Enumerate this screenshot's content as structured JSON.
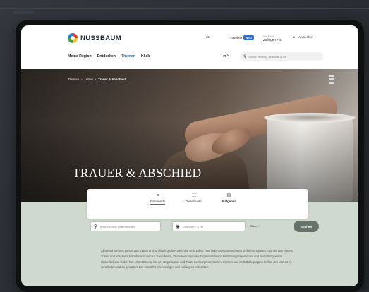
{
  "brand": {
    "name": "NUSSBAUM"
  },
  "header": {
    "lang": "de",
    "business": {
      "label": "Fragebox",
      "badge": "NEU"
    },
    "store": {
      "small": "Ihre Filiale",
      "big": "Zofingen + 4"
    },
    "account": {
      "icon": "person-icon",
      "label": "Anmelden"
    }
  },
  "nav": [
    "Meine Region",
    "Entdecken",
    "Themen",
    "Klick"
  ],
  "nav_active_index": 2,
  "search": {
    "placeholder": "Suche beliebig, Branche & Ort"
  },
  "breadcrumb": [
    "Themen",
    "Leben",
    "Trauer & Abschied"
  ],
  "hero": {
    "title": "TRAUER & ABSCHIED"
  },
  "tabs": [
    {
      "label": "Firmenliste",
      "icon": "list-icon"
    },
    {
      "label": "Dienstleister",
      "icon": "service-icon"
    },
    {
      "label": "Ratgeber",
      "icon": "book-icon"
    }
  ],
  "form": {
    "what_placeholder": "Branche oder Unternehmen",
    "where_placeholder": "Ortschaft + 5 km",
    "radius": "25km",
    "button": "Suchen"
  },
  "intro": "Abschied nehmen gehört zum Leben und ist oft mit großen Gefühlen verbunden. Hier finden Sie Unternehmen und Informationen rund um das Thema Trauer und Abschied. Mit Informationen zu Trauerfeiern, Dienstleistungen der Organisation von Bestattungszeremonien und Bestattungsarten. Hinterbliebene finden hier Unterstützung bei der Organisation und Trost. Seelsorgende Stellen, Kirchen und Selbsthilfegruppen helfen, den Verlust zu verarbeiten und zu gestalten. Der Kunst für Erinnerungen und Heilung zu entdecken.",
  "colors": {
    "accent": "#2d6fd6",
    "panel": "#cfd9cf",
    "button": "#67726a"
  }
}
